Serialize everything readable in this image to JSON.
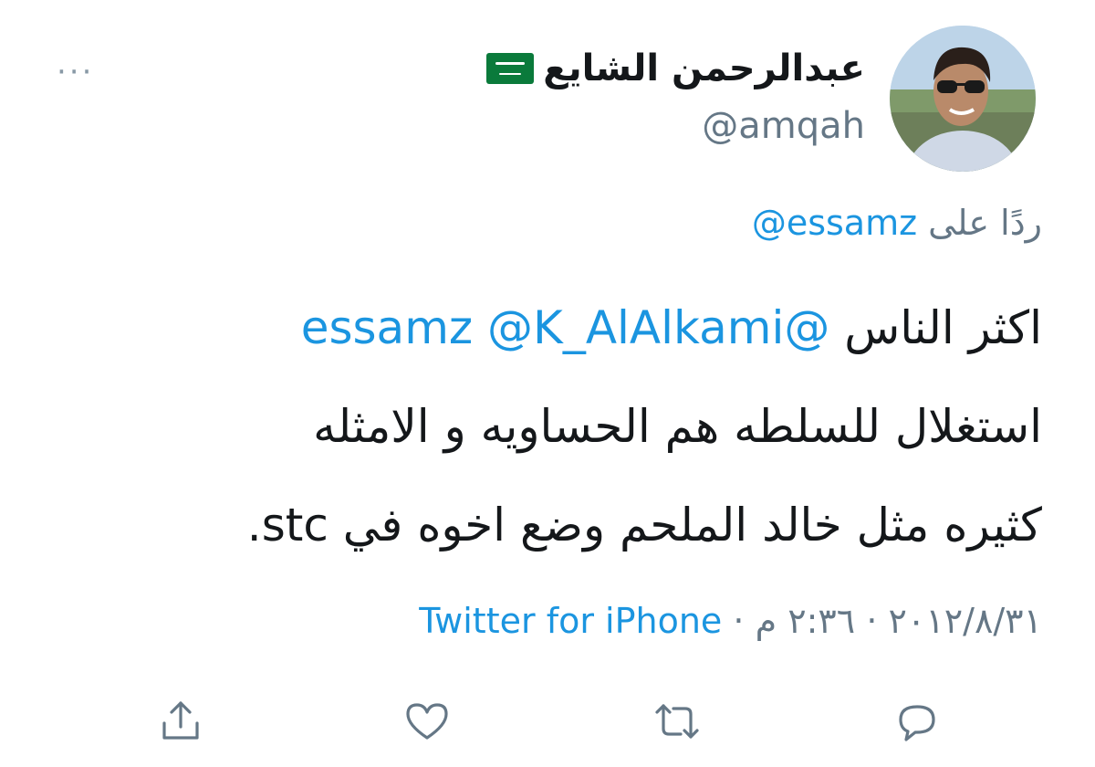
{
  "user": {
    "display_name": "عبدالرحمن الشايع",
    "handle": "@amqah",
    "flag_icon": "saudi-flag-icon"
  },
  "more_label": "···",
  "reply": {
    "prefix": "ردًا على",
    "mention": "@essamz"
  },
  "tweet": {
    "mention_1": "@essamz",
    "mention_2": "@K_AlAlkami",
    "line1_text": "اكثر الناس",
    "line2": "استغلال للسلطه هم الحساويه و الامثله",
    "line3": "كثيره مثل خالد الملحم وضع اخوه في stc."
  },
  "meta": {
    "date": "٢٠١٢/٨/٣١",
    "time": "٢:٣٦ م",
    "separator": "·",
    "source": "Twitter for iPhone"
  },
  "actions": [
    {
      "name": "reply-icon"
    },
    {
      "name": "retweet-icon"
    },
    {
      "name": "like-icon"
    },
    {
      "name": "share-icon"
    }
  ],
  "colors": {
    "link": "#1b95e0",
    "muted": "#657786",
    "text": "#14171a"
  }
}
